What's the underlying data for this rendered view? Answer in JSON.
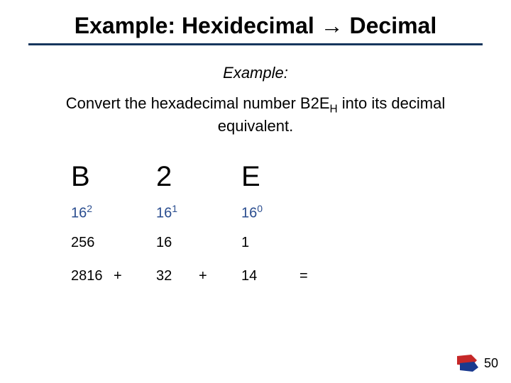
{
  "title": "Example: Hexidecimal → Decimal",
  "example_label": "Example:",
  "instruction_pre": "Convert the hexadecimal number B2E",
  "instruction_sub": "H",
  "instruction_post": " into its decimal equivalent.",
  "digits": [
    "B",
    "2",
    "E"
  ],
  "place_values": [
    {
      "base": "16",
      "exp": "2"
    },
    {
      "base": "16",
      "exp": "1"
    },
    {
      "base": "16",
      "exp": "0"
    }
  ],
  "weights": [
    "256",
    "16",
    "1"
  ],
  "products": [
    "2816",
    "32",
    "14"
  ],
  "ops": [
    "+",
    "+",
    "="
  ],
  "page_number": "50"
}
